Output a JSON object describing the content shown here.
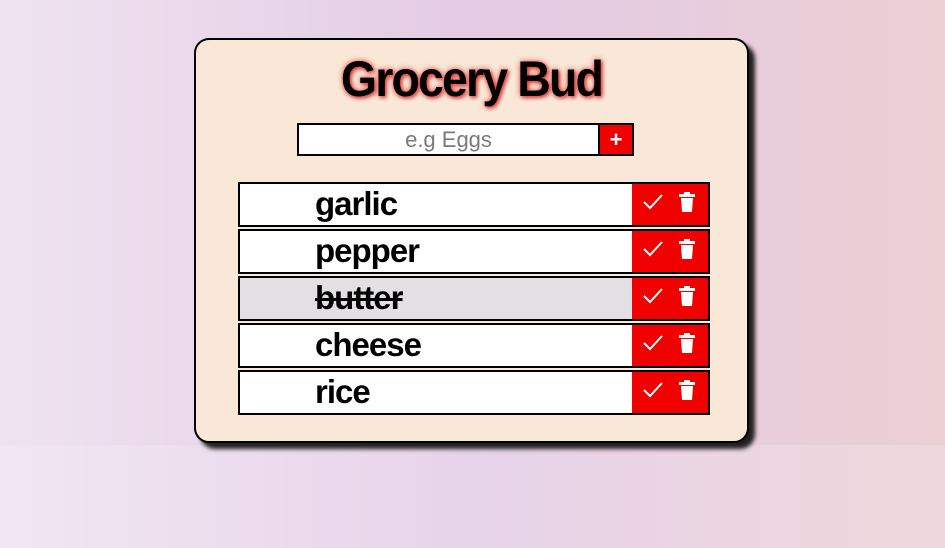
{
  "app": {
    "title": "Grocery Bud"
  },
  "form": {
    "placeholder": "e.g Eggs",
    "value": "",
    "add_label": "+"
  },
  "items": [
    {
      "name": "garlic",
      "done": false,
      "check_icon": "check-icon",
      "delete_icon": "trash-icon"
    },
    {
      "name": "pepper",
      "done": false,
      "check_icon": "check-icon",
      "delete_icon": "trash-icon"
    },
    {
      "name": "butter",
      "done": true,
      "check_icon": "check-icon",
      "delete_icon": "trash-icon"
    },
    {
      "name": "cheese",
      "done": false,
      "check_icon": "check-icon",
      "delete_icon": "trash-icon"
    },
    {
      "name": "rice",
      "done": false,
      "check_icon": "check-icon",
      "delete_icon": "trash-icon"
    }
  ],
  "colors": {
    "accent": "#f10000",
    "card_background": "#f9e8d7",
    "done_row_background": "#e2e0e2"
  }
}
